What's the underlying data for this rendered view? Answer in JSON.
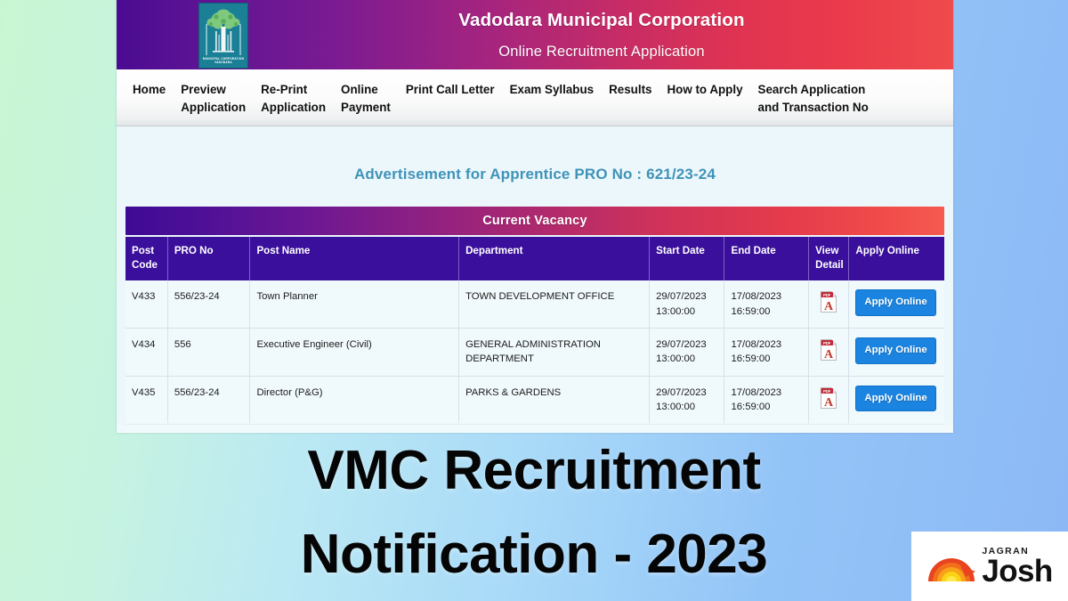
{
  "header": {
    "title": "Vadodara Municipal Corporation",
    "subtitle": "Online Recruitment Application",
    "logo_caption_line1": "MUNICIPAL CORPORATION",
    "logo_caption_line2": "VADODARA",
    "gradient_start": "#4a0c92",
    "gradient_end": "#ef4a4c"
  },
  "nav": {
    "items": [
      {
        "label": "Home"
      },
      {
        "label": "Preview\nApplication"
      },
      {
        "label": "Re-Print\nApplication"
      },
      {
        "label": "Online\nPayment"
      },
      {
        "label": "Print Call Letter"
      },
      {
        "label": "Exam Syllabus"
      },
      {
        "label": "Results"
      },
      {
        "label": "How to Apply"
      },
      {
        "label": "Search Application\nand Transaction No"
      }
    ]
  },
  "content": {
    "advertisement_title": "Advertisement for Apprentice PRO No : 621/23-24",
    "advertisement_title_color": "#3f93b8",
    "banner_label": "Current Vacancy",
    "background_color": "#ecf7fb"
  },
  "table": {
    "columns": [
      {
        "key": "post_code",
        "label": "Post\nCode"
      },
      {
        "key": "pro_no",
        "label": "PRO No"
      },
      {
        "key": "post_name",
        "label": "Post Name"
      },
      {
        "key": "department",
        "label": "Department"
      },
      {
        "key": "start_date",
        "label": "Start Date"
      },
      {
        "key": "end_date",
        "label": "End Date"
      },
      {
        "key": "view_detail",
        "label": "View\nDetail"
      },
      {
        "key": "apply_online",
        "label": "Apply Online"
      }
    ],
    "header_bg": "#3a0f9b",
    "rows": [
      {
        "post_code": "V433",
        "pro_no": "556/23-24",
        "post_name": "Town Planner",
        "department": "TOWN DEVELOPMENT OFFICE",
        "start_date": "29/07/2023\n13:00:00",
        "end_date": "17/08/2023\n16:59:00",
        "view_detail_icon": "pdf-icon",
        "apply_label": "Apply Online"
      },
      {
        "post_code": "V434",
        "pro_no": "556",
        "post_name": "Executive Engineer (Civil)",
        "department": "GENERAL ADMINISTRATION DEPARTMENT",
        "start_date": "29/07/2023\n13:00:00",
        "end_date": "17/08/2023\n16:59:00",
        "view_detail_icon": "pdf-icon",
        "apply_label": "Apply Online"
      },
      {
        "post_code": "V435",
        "pro_no": "556/23-24",
        "post_name": "Director (P&G)",
        "department": "PARKS & GARDENS",
        "start_date": "29/07/2023\n13:00:00",
        "end_date": "17/08/2023\n16:59:00",
        "view_detail_icon": "pdf-icon",
        "apply_label": "Apply Online"
      }
    ],
    "apply_button_color": "#1b84e0"
  },
  "headline": {
    "line1": "VMC Recruitment",
    "line2": "Notification - 2023"
  },
  "branding": {
    "top_text": "JAGRAN",
    "main_text": "Josh",
    "sun_icon": "sunrise-icon"
  }
}
